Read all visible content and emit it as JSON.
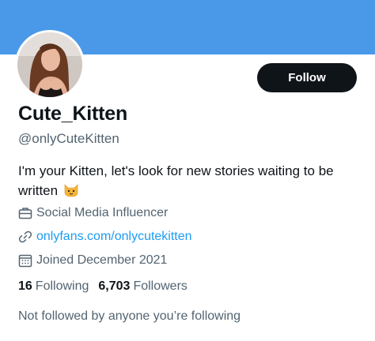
{
  "profile": {
    "display_name": "Cute_Kitten",
    "handle": "@onlyCuteKitten",
    "bio": "I'm your Kitten, let's look for new stories waiting to be written",
    "bio_emoji": "cat-face-emoji",
    "category": "Social Media Influencer",
    "website": "onlyfans.com/onlycutekitten",
    "joined": "Joined December 2021"
  },
  "actions": {
    "follow_label": "Follow"
  },
  "stats": {
    "following_count": "16",
    "following_label": "Following",
    "followers_count": "6,703",
    "followers_label": "Followers"
  },
  "social_context": "Not followed by anyone you’re following",
  "icons": {
    "category": "briefcase-icon",
    "website": "link-icon",
    "joined": "calendar-icon"
  },
  "colors": {
    "banner": "#4a99e9",
    "follow_button": "#0f1419",
    "link": "#1d9bf0",
    "secondary_text": "#536471"
  }
}
